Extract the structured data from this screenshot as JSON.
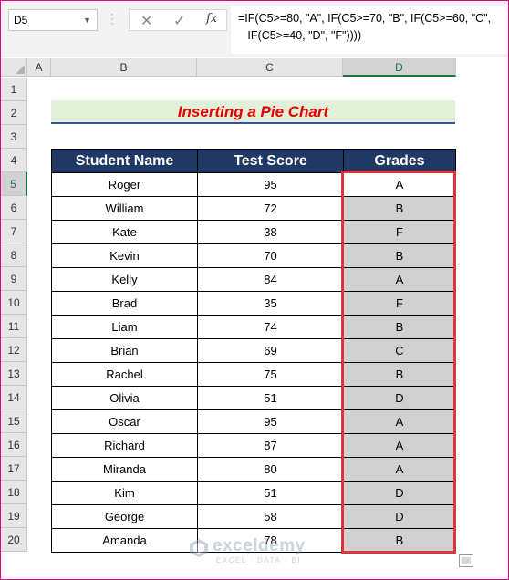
{
  "name_box": {
    "value": "D5"
  },
  "formula_bar": {
    "cancel_label": "✕",
    "enter_label": "✓",
    "fx_label": "fx",
    "formula": "=IF(C5>=80, \"A\", IF(C5>=70, \"B\", IF(C5>=60, \"C\",\n   IF(C5>=40, \"D\", \"F\"))))"
  },
  "columns": [
    "A",
    "B",
    "C",
    "D"
  ],
  "rows": [
    "1",
    "2",
    "3",
    "4",
    "5",
    "6",
    "7",
    "8",
    "9",
    "10",
    "11",
    "12",
    "13",
    "14",
    "15",
    "16",
    "17",
    "18",
    "19",
    "20"
  ],
  "sheet": {
    "title": "Inserting a Pie Chart",
    "headers": [
      "Student Name",
      "Test Score",
      "Grades"
    ],
    "records": [
      {
        "name": "Roger",
        "score": "95",
        "grade": "A"
      },
      {
        "name": "William",
        "score": "72",
        "grade": "B"
      },
      {
        "name": "Kate",
        "score": "38",
        "grade": "F"
      },
      {
        "name": "Kevin",
        "score": "70",
        "grade": "B"
      },
      {
        "name": "Kelly",
        "score": "84",
        "grade": "A"
      },
      {
        "name": "Brad",
        "score": "35",
        "grade": "F"
      },
      {
        "name": "Liam",
        "score": "74",
        "grade": "B"
      },
      {
        "name": "Brian",
        "score": "69",
        "grade": "C"
      },
      {
        "name": "Rachel",
        "score": "75",
        "grade": "B"
      },
      {
        "name": "Olivia",
        "score": "51",
        "grade": "D"
      },
      {
        "name": "Oscar",
        "score": "95",
        "grade": "A"
      },
      {
        "name": "Richard",
        "score": "87",
        "grade": "A"
      },
      {
        "name": "Miranda",
        "score": "80",
        "grade": "A"
      },
      {
        "name": "Kim",
        "score": "51",
        "grade": "D"
      },
      {
        "name": "George",
        "score": "58",
        "grade": "D"
      },
      {
        "name": "Amanda",
        "score": "78",
        "grade": "B"
      }
    ]
  },
  "watermark": {
    "name": "exceldemy",
    "tagline": "EXCEL · DATA · BI"
  },
  "colors": {
    "header_fill": "#203864",
    "title_fill": "#e2efd9",
    "title_text": "#e00000",
    "selection": "#e2323a"
  }
}
